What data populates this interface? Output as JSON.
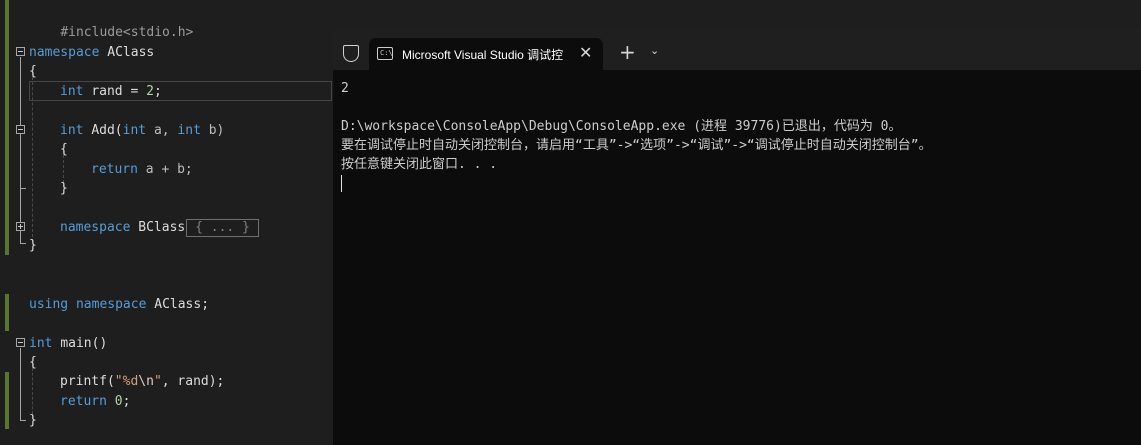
{
  "editor": {
    "line1": "#include<stdio.h>",
    "ns_kw": "namespace",
    "ns_name": "AClass",
    "open_brace": "{",
    "close_brace": "}",
    "int_kw": "int",
    "rand_decl": "rand = ",
    "rand_val": "2",
    "semicolon": ";",
    "add_fn": "Add(",
    "param_a": "a, ",
    "param_b": "b)",
    "return_kw": "return",
    "return_expr": "a + b;",
    "ns2_name": "BClass",
    "collapsed_text": "{ ... }",
    "using_kw": "using",
    "using_name": "AClass;",
    "main_fn": "main()",
    "printf_call": "printf(",
    "fmt_open": "\"%d",
    "fmt_esc": "\\n",
    "fmt_close": "\"",
    "printf_args": ", rand);",
    "return_zero": "0",
    "paren_open": "(",
    "paren_close": ")"
  },
  "terminal": {
    "tab_title": "Microsoft Visual Studio 调试控",
    "tab_icon": "C:\\",
    "close_glyph": "✕",
    "new_tab_glyph": "+",
    "dropdown_glyph": "⌄",
    "output": [
      "2",
      "",
      "D:\\workspace\\ConsoleApp\\Debug\\ConsoleApp.exe (进程 39776)已退出，代码为 0。",
      "要在调试停止时自动关闭控制台，请启用“工具”->“选项”->“调试”->“调试停止时自动关闭控制台”。",
      "按任意键关闭此窗口. . ."
    ]
  },
  "icons": [
    "shield-icon",
    "terminal-icon",
    "close-icon",
    "plus-icon",
    "chevron-down-icon"
  ],
  "colors": {
    "keyword": "#569cd6",
    "string": "#d69d85",
    "change_bar": "#577430",
    "terminal_bg": "#0c0c0c"
  }
}
